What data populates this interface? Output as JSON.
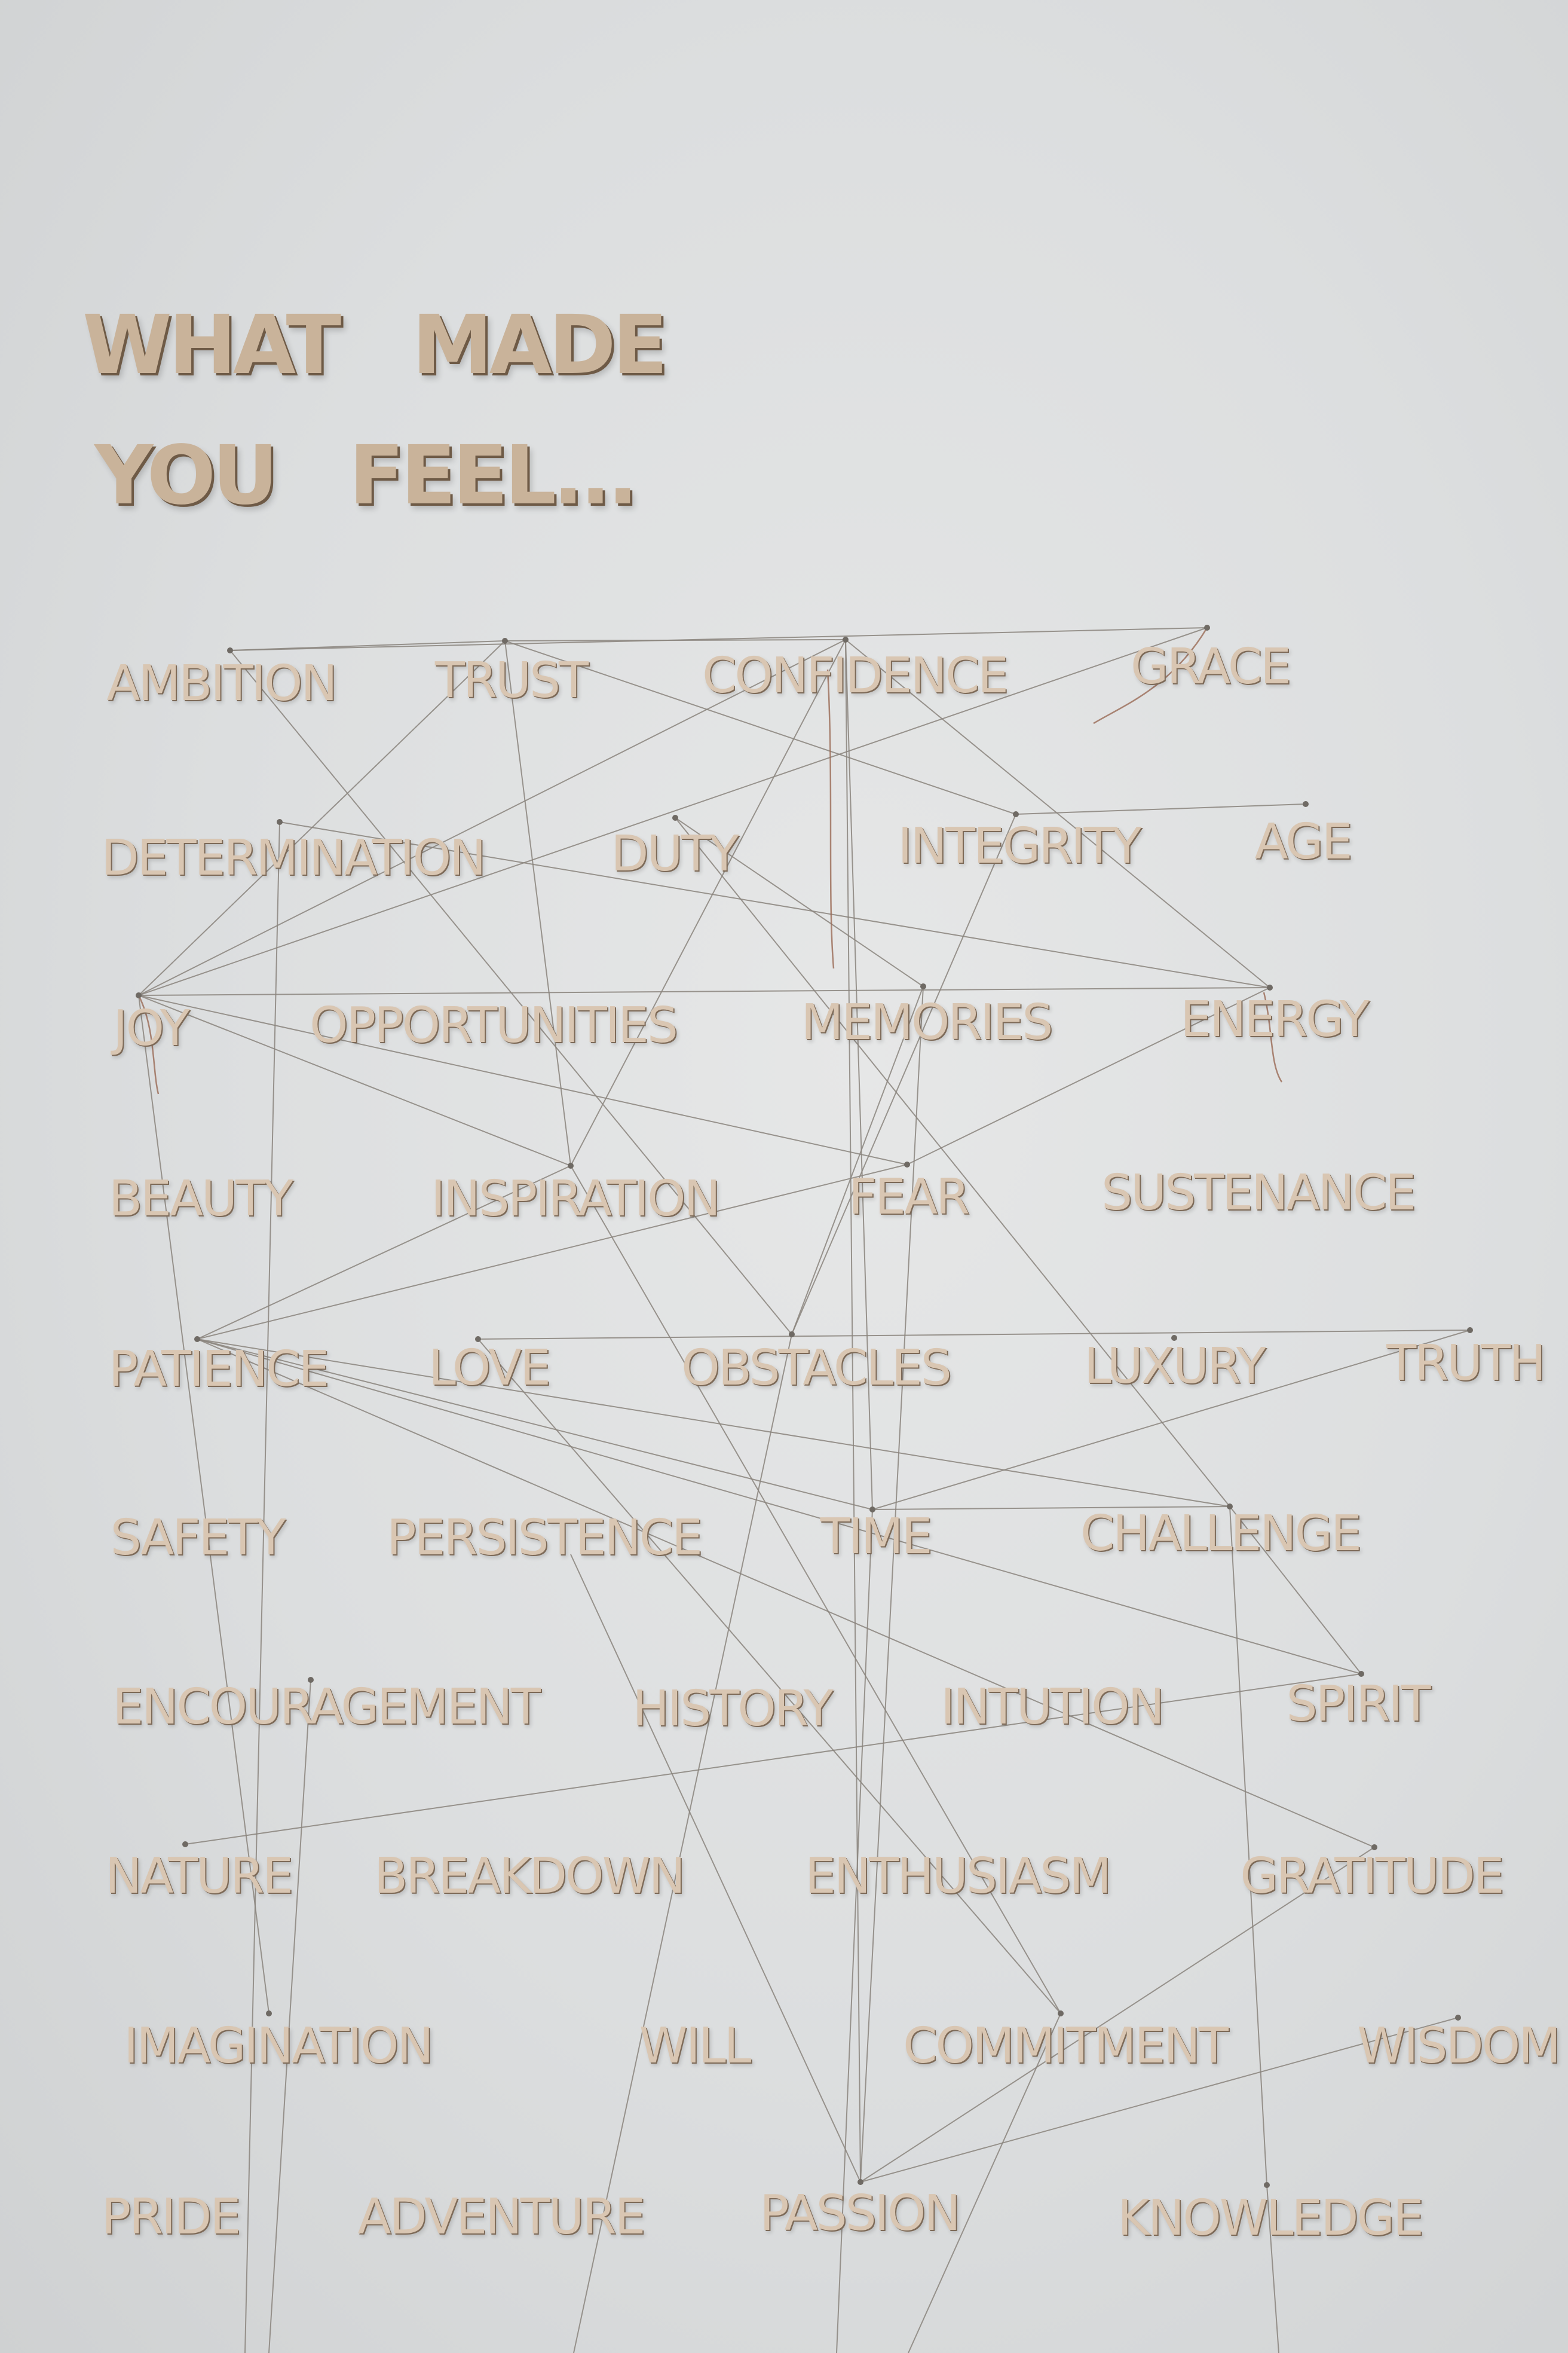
{
  "heading": {
    "line1": "WHAT   MADE",
    "line2": "YOU   FEEL..."
  },
  "words": [
    [
      "AMBITION",
      "TRUST",
      "CONFIDENCE",
      "GRACE"
    ],
    [
      "DETERMINATION",
      "DUTY",
      "INTEGRITY",
      "AGE"
    ],
    [
      "JOY",
      "OPPORTUNITIES",
      "MEMORIES",
      "ENERGY"
    ],
    [
      "BEAUTY",
      "INSPIRATION",
      "FEAR",
      "SUSTENANCE"
    ],
    [
      "PATIENCE",
      "LOVE",
      "OBSTACLES",
      "LUXURY",
      "TRUTH"
    ],
    [
      "SAFETY",
      "PERSISTENCE",
      "TIME",
      "CHALLENGE"
    ],
    [
      "ENCOURAGEMENT",
      "HISTORY",
      "INTUTION",
      "SPIRIT"
    ],
    [
      "NATURE",
      "BREAKDOWN",
      "ENTHUSIASM",
      "GRATITUDE"
    ],
    [
      "IMAGINATION",
      "WILL",
      "COMMITMENT",
      "WISDOM"
    ],
    [
      "PRIDE",
      "ADVENTURE",
      "PASSION",
      "KNOWLEDGE"
    ]
  ]
}
